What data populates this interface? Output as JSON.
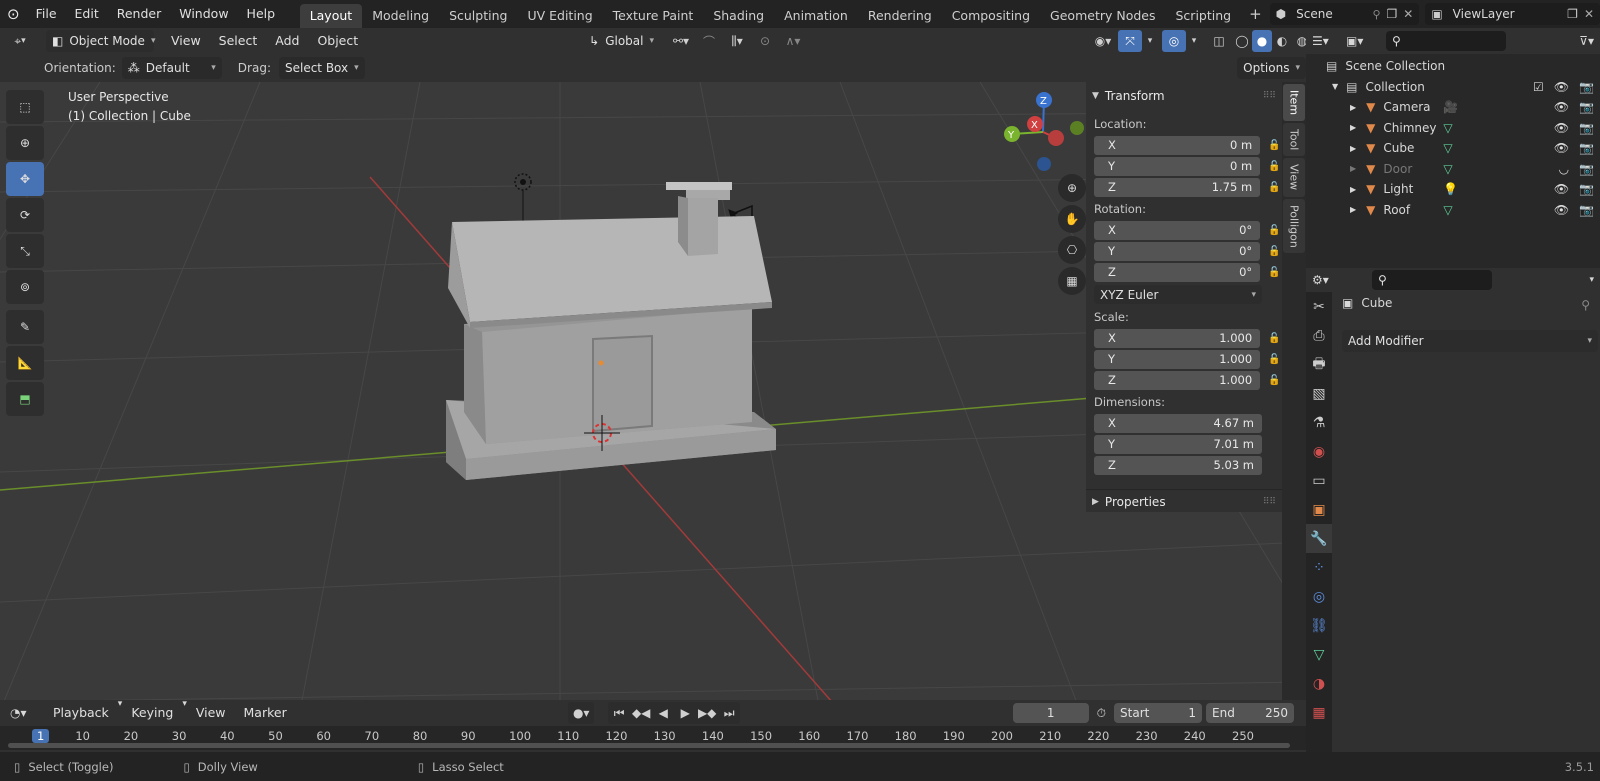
{
  "topbar": {
    "menus": [
      "File",
      "Edit",
      "Render",
      "Window",
      "Help"
    ],
    "workspaces": [
      "Layout",
      "Modeling",
      "Sculpting",
      "UV Editing",
      "Texture Paint",
      "Shading",
      "Animation",
      "Rendering",
      "Compositing",
      "Geometry Nodes",
      "Scripting"
    ],
    "active_workspace": "Layout",
    "scene": "Scene",
    "view_layer": "ViewLayer"
  },
  "header": {
    "mode": "Object Mode",
    "menus": [
      "View",
      "Select",
      "Add",
      "Object"
    ],
    "transform_orientation": "Global"
  },
  "tool_options": {
    "orientation_label": "Orientation:",
    "orientation_value": "Default",
    "drag_label": "Drag:",
    "drag_value": "Select Box",
    "options_label": "Options"
  },
  "viewport": {
    "perspective": "User Perspective",
    "context": "(1) Collection | Cube"
  },
  "npanel": {
    "transform_title": "Transform",
    "location_label": "Location:",
    "location": [
      {
        "axis": "X",
        "value": "0 m"
      },
      {
        "axis": "Y",
        "value": "0 m"
      },
      {
        "axis": "Z",
        "value": "1.75 m"
      }
    ],
    "rotation_label": "Rotation:",
    "rotation": [
      {
        "axis": "X",
        "value": "0°"
      },
      {
        "axis": "Y",
        "value": "0°"
      },
      {
        "axis": "Z",
        "value": "0°"
      }
    ],
    "rotation_mode": "XYZ Euler",
    "scale_label": "Scale:",
    "scale": [
      {
        "axis": "X",
        "value": "1.000"
      },
      {
        "axis": "Y",
        "value": "1.000"
      },
      {
        "axis": "Z",
        "value": "1.000"
      }
    ],
    "dimensions_label": "Dimensions:",
    "dimensions": [
      {
        "axis": "X",
        "value": "4.67 m"
      },
      {
        "axis": "Y",
        "value": "7.01 m"
      },
      {
        "axis": "Z",
        "value": "5.03 m"
      }
    ],
    "properties_title": "Properties",
    "tabs": [
      "Item",
      "Tool",
      "View",
      "Polligon"
    ]
  },
  "outliner": {
    "scene_collection": "Scene Collection",
    "collection": "Collection",
    "items": [
      {
        "name": "Camera",
        "icon": "camera-icon",
        "color": "#e0894a"
      },
      {
        "name": "Chimney",
        "icon": "mesh-icon",
        "color": "#e0894a"
      },
      {
        "name": "Cube",
        "icon": "mesh-icon",
        "color": "#e0894a"
      },
      {
        "name": "Door",
        "icon": "mesh-icon",
        "color": "#e0894a"
      },
      {
        "name": "Light",
        "icon": "light-icon",
        "color": "#e0894a"
      },
      {
        "name": "Roof",
        "icon": "mesh-icon",
        "color": "#e0894a"
      }
    ]
  },
  "properties": {
    "object_name": "Cube",
    "add_modifier": "Add Modifier"
  },
  "timeline": {
    "menus": [
      "Playback",
      "Keying",
      "View",
      "Marker"
    ],
    "current_frame": "1",
    "start_label": "Start",
    "start": "1",
    "end_label": "End",
    "end": "250",
    "ticks": [
      "1",
      "10",
      "20",
      "30",
      "40",
      "50",
      "60",
      "70",
      "80",
      "90",
      "100",
      "110",
      "120",
      "130",
      "140",
      "150",
      "160",
      "170",
      "180",
      "190",
      "200",
      "210",
      "220",
      "230",
      "240",
      "250"
    ]
  },
  "status": {
    "items": [
      "Select (Toggle)",
      "Dolly View",
      "Lasso Select"
    ],
    "version": "3.5.1"
  }
}
